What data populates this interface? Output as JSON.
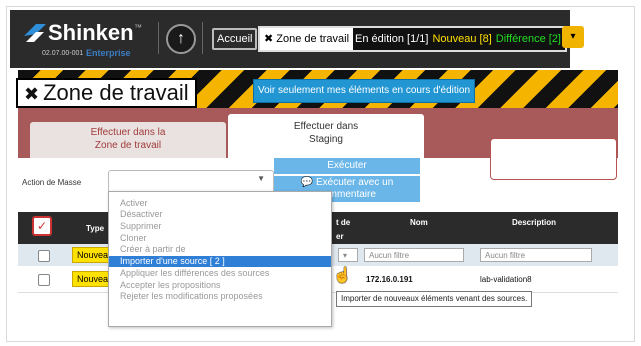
{
  "app": {
    "brand": "Shinken",
    "brand_tm": "™",
    "version": "02.07.00-001",
    "edition": "Enterprise"
  },
  "nav": {
    "accueil": "Accueil",
    "workzone_label": "Zone de travail",
    "workzone_editing": "En édition [1/1]",
    "workzone_new": "Nouveau [8]",
    "workzone_diff": "Différence [2]"
  },
  "banner": {
    "title": "Zone de travail",
    "mine_button": "Voir seulement mes éléments en cours d'édition"
  },
  "tabs": {
    "tab1_line1": "Effectuer dans la",
    "tab1_line2": "Zone de travail",
    "tab2_line1": "Effectuer dans",
    "tab2_line2": "Staging"
  },
  "mass_action": {
    "label": "Action de Masse",
    "execute": "Exécuter",
    "execute_comment_line1": "Exécuter avec un",
    "execute_comment_line2": "commentaire"
  },
  "table": {
    "headers": {
      "type": "Type",
      "etat_line1": "t de",
      "etat_line2": "er",
      "nom": "Nom",
      "description": "Description"
    },
    "filter_row": {
      "status": "Nouveau",
      "filter_placeholder": "Aucun filtre"
    },
    "rows": [
      {
        "status": "Nouveau",
        "name": "172.16.0.191",
        "description": "lab-validation8"
      }
    ]
  },
  "menu": {
    "items": [
      "Activer",
      "Désactiver",
      "Supprimer",
      "Cloner",
      "Créer à partir de",
      "Importer d'une source [ 2 ]",
      "Appliquer les différences des sources",
      "Accepter les propositions",
      "Rejeter les modifications proposées"
    ],
    "highlighted_index": 5
  },
  "tooltip": {
    "text": "Importer de nouveaux éléments venant des sources."
  },
  "colors": {
    "accent_blue": "#2196d3",
    "highlight": "#2f7fd6",
    "new_badge": "#ffe100",
    "diff_green": "#22dd22"
  }
}
